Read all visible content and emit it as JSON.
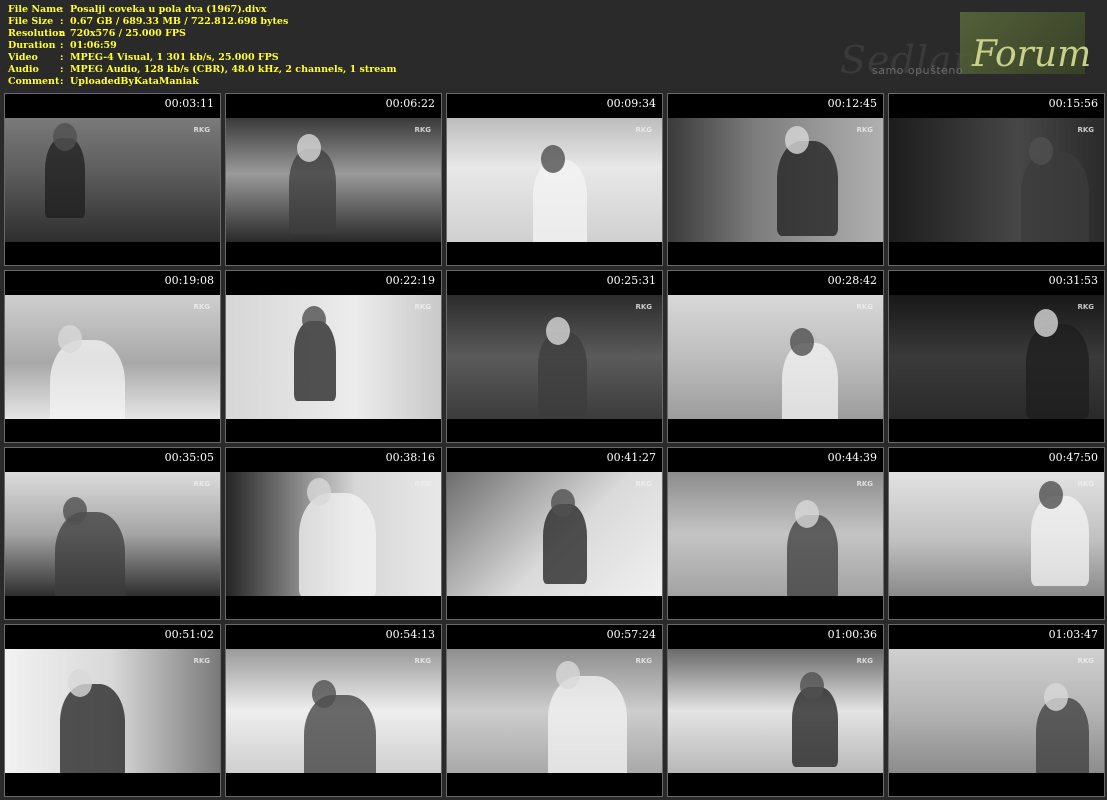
{
  "info": {
    "rows": [
      {
        "key": "File Name",
        "value": "Posalji coveka u pola dva (1967).divx"
      },
      {
        "key": "File Size",
        "value": "0.67 GB  / 689.33 MB  / 722.812.698  bytes"
      },
      {
        "key": "Resolution",
        "value": "720x576 / 25.000 FPS"
      },
      {
        "key": "Duration",
        "value": "01:06:59"
      },
      {
        "key": "Video",
        "value": "MPEG-4 Visual, 1 301 kb/s, 25.000 FPS"
      },
      {
        "key": "Audio",
        "value": "MPEG Audio, 128 kb/s (CBR), 48.0 kHz, 2 channels, 1 stream"
      },
      {
        "key": "Comment",
        "value": "UploadedByKataManiak"
      }
    ],
    "separator": ":"
  },
  "logo": {
    "faint_text": "Sedlan",
    "main_text": "Forum",
    "subtitle": "samo opušteno"
  },
  "watermark": "RKG",
  "thumbnails": [
    {
      "timestamp": "00:03:11",
      "scene": "s1"
    },
    {
      "timestamp": "00:06:22",
      "scene": "s2"
    },
    {
      "timestamp": "00:09:34",
      "scene": "s3"
    },
    {
      "timestamp": "00:12:45",
      "scene": "s4"
    },
    {
      "timestamp": "00:15:56",
      "scene": "s5"
    },
    {
      "timestamp": "00:19:08",
      "scene": "s6"
    },
    {
      "timestamp": "00:22:19",
      "scene": "s7"
    },
    {
      "timestamp": "00:25:31",
      "scene": "s8"
    },
    {
      "timestamp": "00:28:42",
      "scene": "s9"
    },
    {
      "timestamp": "00:31:53",
      "scene": "s10"
    },
    {
      "timestamp": "00:35:05",
      "scene": "s11"
    },
    {
      "timestamp": "00:38:16",
      "scene": "s12"
    },
    {
      "timestamp": "00:41:27",
      "scene": "s13"
    },
    {
      "timestamp": "00:44:39",
      "scene": "s14"
    },
    {
      "timestamp": "00:47:50",
      "scene": "s15"
    },
    {
      "timestamp": "00:51:02",
      "scene": "s16"
    },
    {
      "timestamp": "00:54:13",
      "scene": "s17"
    },
    {
      "timestamp": "00:57:24",
      "scene": "s18"
    },
    {
      "timestamp": "01:00:36",
      "scene": "s19"
    },
    {
      "timestamp": "01:03:47",
      "scene": "s20"
    }
  ],
  "colors": {
    "background": "#2a2a2a",
    "info_text": "#ffff33",
    "timestamp_text": "#ffffff",
    "thumb_border": "#6a6a6a"
  }
}
